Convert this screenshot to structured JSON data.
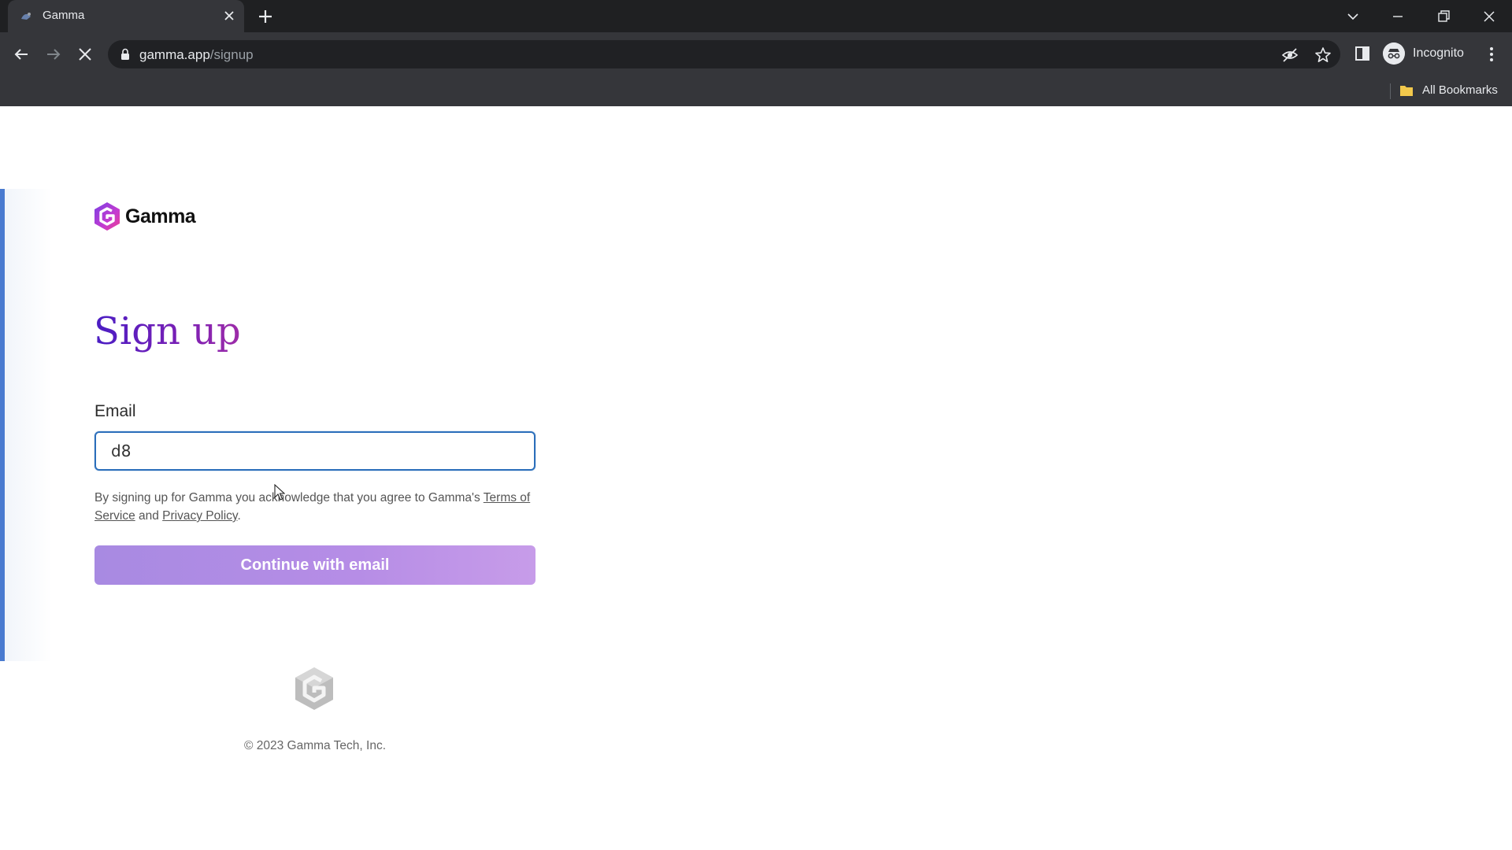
{
  "browser": {
    "tab_title": "Gamma",
    "url_host": "gamma.app",
    "url_path": "/signup",
    "profile_label": "Incognito",
    "bookmarks_label": "All Bookmarks"
  },
  "page": {
    "logo_text": "Gamma",
    "heading": "Sign up",
    "email_label": "Email",
    "email_value": "d8",
    "legal_prefix": "By signing up for Gamma you acknowledge that you agree to Gamma's ",
    "terms_link": "Terms of Service",
    "legal_and": " and ",
    "privacy_link": "Privacy Policy",
    "legal_suffix": ".",
    "continue_button": "Continue with email",
    "copyright": "© 2023 Gamma Tech, Inc."
  },
  "colors": {
    "chrome_dark": "#1f2022",
    "chrome_toolbar": "#35363a",
    "heading_gradient_start": "#4a1ec4",
    "heading_gradient_end": "#9e2ca8",
    "input_focus_border": "#2c6fbb",
    "button_gradient_start": "#a88ae2",
    "button_gradient_end": "#c79ce9"
  },
  "icons": [
    "favicon-icon",
    "close-icon",
    "plus-icon",
    "chevron-down-icon",
    "minimize-icon",
    "restore-icon",
    "window-close-icon",
    "back-arrow-icon",
    "forward-arrow-icon",
    "stop-loading-icon",
    "lock-icon",
    "eye-off-icon",
    "star-icon",
    "side-panel-icon",
    "incognito-icon",
    "more-vert-icon",
    "folder-icon",
    "gamma-logo-icon",
    "cursor-icon"
  ]
}
